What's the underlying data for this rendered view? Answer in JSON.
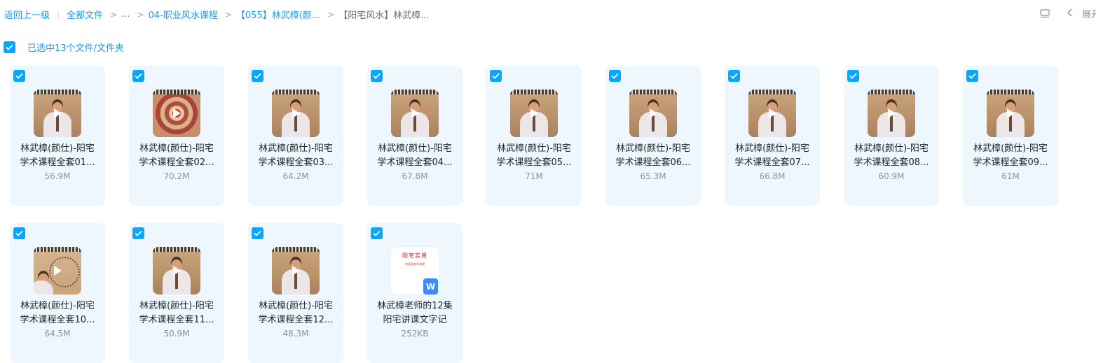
{
  "breadcrumb": {
    "back": "返回上一级",
    "all_files": "全部文件",
    "ellipsis": "...",
    "level1": "04-职业风水课程",
    "level2": "【055】林武樟(颜...",
    "current": "【阳宅风水】林武樟..."
  },
  "toolbar": {
    "view_icon": "list-view-icon",
    "collapse_label": "展开"
  },
  "selection": {
    "text": "已选中13个文件/文件夹",
    "checked": true
  },
  "files": [
    {
      "line1": "林武樟(颜仕)-阳宅",
      "line2": "学术课程全套01...",
      "size": "56.9M",
      "thumb": "video"
    },
    {
      "line1": "林武樟(颜仕)-阳宅",
      "line2": "学术课程全套02...",
      "size": "70.2M",
      "thumb": "compass"
    },
    {
      "line1": "林武樟(颜仕)-阳宅",
      "line2": "学术课程全套03...",
      "size": "64.2M",
      "thumb": "video"
    },
    {
      "line1": "林武樟(颜仕)-阳宅",
      "line2": "学术课程全套04...",
      "size": "67.8M",
      "thumb": "video"
    },
    {
      "line1": "林武樟(颜仕)-阳宅",
      "line2": "学术课程全套05...",
      "size": "71M",
      "thumb": "video"
    },
    {
      "line1": "林武樟(颜仕)-阳宅",
      "line2": "学术课程全套06...",
      "size": "65.3M",
      "thumb": "video"
    },
    {
      "line1": "林武樟(颜仕)-阳宅",
      "line2": "学术课程全套07...",
      "size": "66.8M",
      "thumb": "video"
    },
    {
      "line1": "林武樟(颜仕)-阳宅",
      "line2": "学术课程全套08...",
      "size": "60.9M",
      "thumb": "video"
    },
    {
      "line1": "林武樟(颜仕)-阳宅",
      "line2": "学术课程全套09...",
      "size": "61M",
      "thumb": "video"
    },
    {
      "line1": "林武樟(颜仕)-阳宅",
      "line2": "学术课程全套10...",
      "size": "64.5M",
      "thumb": "board"
    },
    {
      "line1": "林武樟(颜仕)-阳宅",
      "line2": "学术课程全套11...",
      "size": "50.9M",
      "thumb": "video"
    },
    {
      "line1": "林武樟(颜仕)-阳宅",
      "line2": "学术课程全套12...",
      "size": "48.3M",
      "thumb": "video"
    },
    {
      "line1": "林武樟老师的12集",
      "line2": "阳宅讲课文字记",
      "size": "252KB",
      "thumb": "doc",
      "doc_title": "阳宅实用",
      "doc_sub": "林武樟老师讲课",
      "badge": "W"
    }
  ],
  "colors": {
    "accent": "#06a7ff",
    "link": "#1a9aee",
    "card_bg": "#eef7fd",
    "word_badge": "#3d8bf7"
  }
}
